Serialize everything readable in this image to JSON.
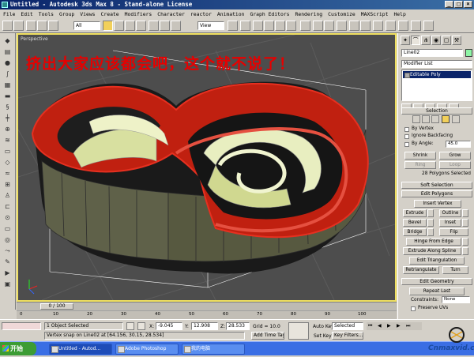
{
  "window": {
    "title": "Untitled - Autodesk 3ds Max 8  - Stand-alone License",
    "buttons": [
      "_",
      "□",
      "×"
    ]
  },
  "menu": [
    "File",
    "Edit",
    "Tools",
    "Group",
    "Views",
    "Create",
    "Modifiers",
    "Character",
    "reactor",
    "Animation",
    "Graph Editors",
    "Rendering",
    "Customize",
    "MAXScript",
    "Help"
  ],
  "toolbar": {
    "selection_filter": "All",
    "ref_coord": "View"
  },
  "viewport": {
    "label": "Perspective",
    "overlay_text": "挤出大家应该都会吧，这个就不说了！"
  },
  "command_panel": {
    "object_name": "Line02",
    "modifier_list": "Modifier List",
    "stack_item": "Editable Poly",
    "colors": {
      "object_color": "#8ef5a5"
    },
    "selection": {
      "header": "Selection",
      "by_vertex": "By Vertex",
      "ignore_backfacing": "Ignore Backfacing",
      "by_angle": "By Angle:",
      "angle_value": "45.0",
      "shrink": "Shrink",
      "grow": "Grow",
      "ring": "Ring",
      "loop": "Loop",
      "status": "28 Polygons Selected"
    },
    "soft_selection": {
      "header": "Soft Selection"
    },
    "edit_polygons": {
      "header": "Edit Polygons",
      "insert_vertex": "Insert Vertex",
      "extrude": "Extrude",
      "outline": "Outline",
      "bevel": "Bevel",
      "inset": "Inset",
      "bridge": "Bridge",
      "flip": "Flip",
      "hinge_from_edge": "Hinge From Edge",
      "extrude_along_spline": "Extrude Along Spline",
      "edit_triangulation": "Edit Triangulation",
      "retriangulate": "Retriangulate",
      "turn": "Turn"
    },
    "edit_geometry": {
      "header": "Edit Geometry",
      "repeat_last": "Repeat Last",
      "constraints_label": "Constraints:",
      "constraints_value": "None",
      "preserve_uvs": "Preserve UVs"
    }
  },
  "timeline": {
    "slider": "0 / 100",
    "ticks": [
      "0",
      "10",
      "20",
      "30",
      "40",
      "50",
      "60",
      "70",
      "80",
      "90",
      "100"
    ]
  },
  "status_bar": {
    "objects_selected": "1 Object Selected",
    "prompt": "Vertex snap on Line02 at [64.156, 30.15, 28.534]",
    "x_label": "X:",
    "x_value": "-9.045",
    "y_label": "Y:",
    "y_value": "12.908",
    "z_label": "Z:",
    "z_value": "28.533",
    "grid": "Grid = 10.0",
    "add_time_tag": "Add Time Tag",
    "auto_key": "Auto Key",
    "auto_key_value": "Selected",
    "set_key": "Set Key",
    "key_filters": "Key Filters..."
  },
  "taskbar": {
    "start": "开始",
    "items": [
      "Untitled - Autod...",
      "Adobe Photoshop",
      "我的电脑"
    ]
  },
  "watermark": "Cnmaxvid.com"
}
